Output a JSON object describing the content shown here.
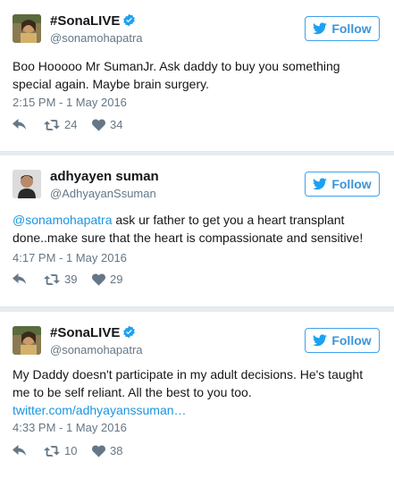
{
  "colors": {
    "background": "#e6ecf0",
    "accent": "#1b95e0",
    "follow_border": "#3ea1ec",
    "muted": "#657786",
    "verified": "#1da1f2"
  },
  "tweets": [
    {
      "display_name": "#SonaLIVE",
      "verified": true,
      "handle": "@sonamohapatra",
      "follow_label": "Follow",
      "text": "Boo Hooooo Mr SumanJr. Ask daddy to buy you something special again. Maybe brain surgery.",
      "timestamp": "2:15 PM - 1 May 2016",
      "retweets": "24",
      "likes": "34"
    },
    {
      "display_name": "adhyayen suman",
      "verified": false,
      "handle": "@AdhyayanSsuman",
      "follow_label": "Follow",
      "mention": "@sonamohapatra",
      "text": " ask ur father to get you a heart transplant done..make sure that the heart is compassionate and sensitive!",
      "timestamp": "4:17 PM - 1 May 2016",
      "retweets": "39",
      "likes": "29"
    },
    {
      "display_name": "#SonaLIVE",
      "verified": true,
      "handle": "@sonamohapatra",
      "follow_label": "Follow",
      "text": "My Daddy doesn't participate in my adult decisions. He's taught me to be self reliant. All the best to you too.",
      "link": "twitter.com/adhyayanssuman…",
      "timestamp": "4:33 PM - 1 May 2016",
      "retweets": "10",
      "likes": "38"
    }
  ]
}
